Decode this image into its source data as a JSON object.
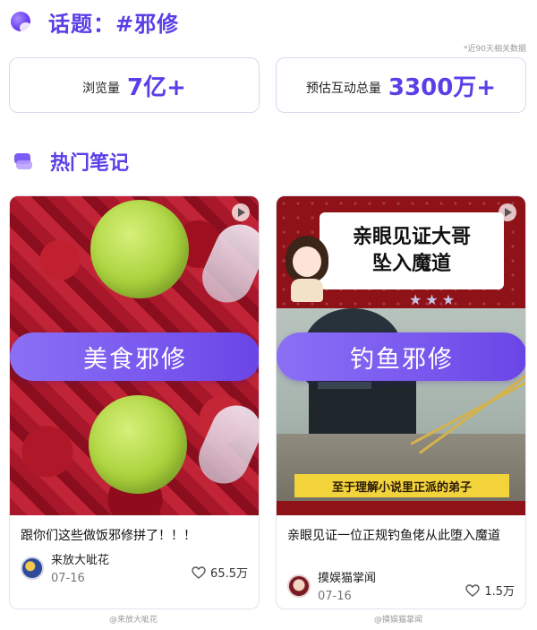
{
  "header": {
    "topic_title": "话题：#邪修",
    "logo_icon": "topic-logo-icon",
    "accent_color": "#5a3ee8"
  },
  "disclaimer": "*近90天相关数据",
  "stats": {
    "views_label": "浏览量",
    "views_value": "7亿+",
    "interactions_label": "预估互动总量",
    "interactions_value": "3300万+"
  },
  "section": {
    "title": "热门笔记",
    "icon": "layers-icon"
  },
  "notes": [
    {
      "pill_label": "美食邪修",
      "title": "跟你们这些做饭邪修拼了！！！",
      "author": "来放大呲花",
      "date": "07-16",
      "likes": "65.5万",
      "credit": "@来放大呲花"
    },
    {
      "pill_label": "钓鱼邪修",
      "cover_banner_line1": "亲眼见证大哥",
      "cover_banner_line2": "坠入魔道",
      "cover_subtitle": "至于理解小说里正派的弟子",
      "title": "亲眼见证一位正规钓鱼佬从此堕入魔道",
      "author": "摸娱猫掌闻",
      "date": "07-16",
      "likes": "1.5万",
      "credit": "@摸娱猫掌闻"
    }
  ]
}
